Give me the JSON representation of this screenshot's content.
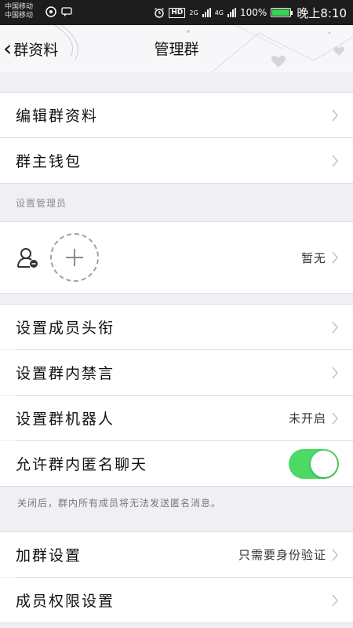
{
  "status_bar": {
    "carrier1": "中国移动",
    "carrier2": "中国移动",
    "hd": "HD",
    "net1": "2G",
    "net2": "4G",
    "battery_percent": "100%",
    "battery_level": 1.0,
    "time": "晚上8:10"
  },
  "nav": {
    "back_label": "群资料",
    "title": "管理群"
  },
  "rows": {
    "edit_profile": "编辑群资料",
    "owner_wallet": "群主钱包",
    "admin_section_label": "设置管理员",
    "admin_value": "暂无",
    "member_title": "设置成员头衔",
    "group_mute": "设置群内禁言",
    "group_robot": "设置群机器人",
    "group_robot_value": "未开启",
    "anonymous_chat": "允许群内匿名聊天",
    "anonymous_footnote": "关闭后，群内所有成员将无法发送匿名消息。",
    "join_settings": "加群设置",
    "join_settings_value": "只需要身份验证",
    "member_permissions": "成员权限设置"
  },
  "toggle_on": true,
  "colors": {
    "toggle_on": "#4cd964",
    "background": "#f0eff4",
    "battery": "#3ad25a"
  }
}
